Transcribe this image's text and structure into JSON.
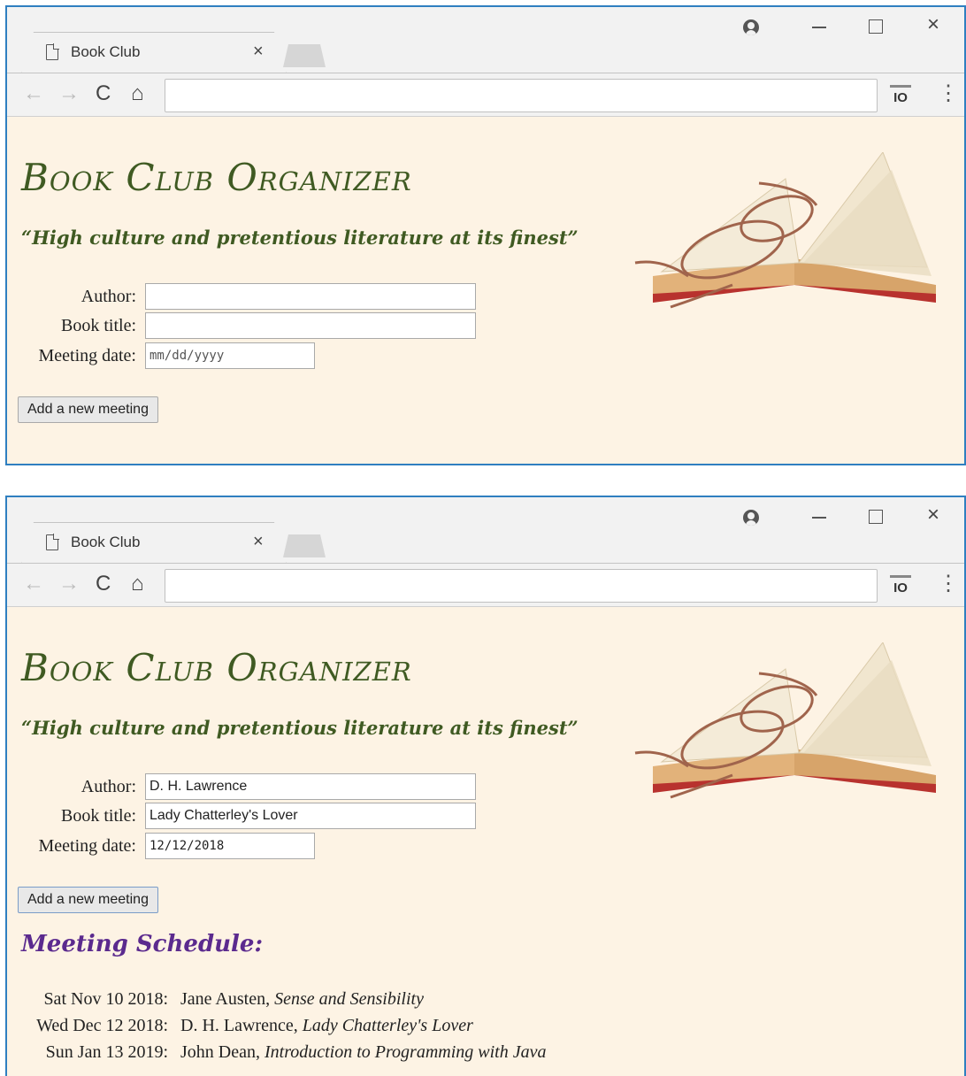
{
  "browser": {
    "tab_title": "Book Club",
    "tab_close": "×",
    "win_close": "×",
    "ext_label": "IO",
    "menu_glyph": "⋮",
    "back_glyph": "←",
    "fwd_glyph": "→",
    "reload_glyph": "C",
    "home_glyph": "⌂"
  },
  "page": {
    "title": "Book Club Organizer",
    "tagline": "“High culture and pretentious literature at its finest”"
  },
  "form": {
    "author_label": "Author:",
    "title_label": "Book title:",
    "date_label": "Meeting date:",
    "button_label": "Add a new meeting"
  },
  "screen1": {
    "author_value": "",
    "title_value": "",
    "date_placeholder": "mm/dd/yyyy"
  },
  "screen2": {
    "author_value": "D. H. Lawrence",
    "title_value": "Lady Chatterley's Lover",
    "date_value": "12/12/2018",
    "schedule_heading": "Meeting Schedule:",
    "meetings": [
      {
        "date": "Sat Nov 10 2018:",
        "author": "Jane Austen, ",
        "book": "Sense and Sensibility"
      },
      {
        "date": "Wed Dec 12 2018:",
        "author": "D. H. Lawrence, ",
        "book": "Lady Chatterley's Lover"
      },
      {
        "date": "Sun Jan 13 2019:",
        "author": "John Dean, ",
        "book": "Introduction to Programming with Java"
      }
    ]
  },
  "colors": {
    "page_bg": "#fdf3e4",
    "title_green": "#3f5a22",
    "schedule_purple": "#5b2a8e",
    "window_border": "#2f7fc0"
  }
}
